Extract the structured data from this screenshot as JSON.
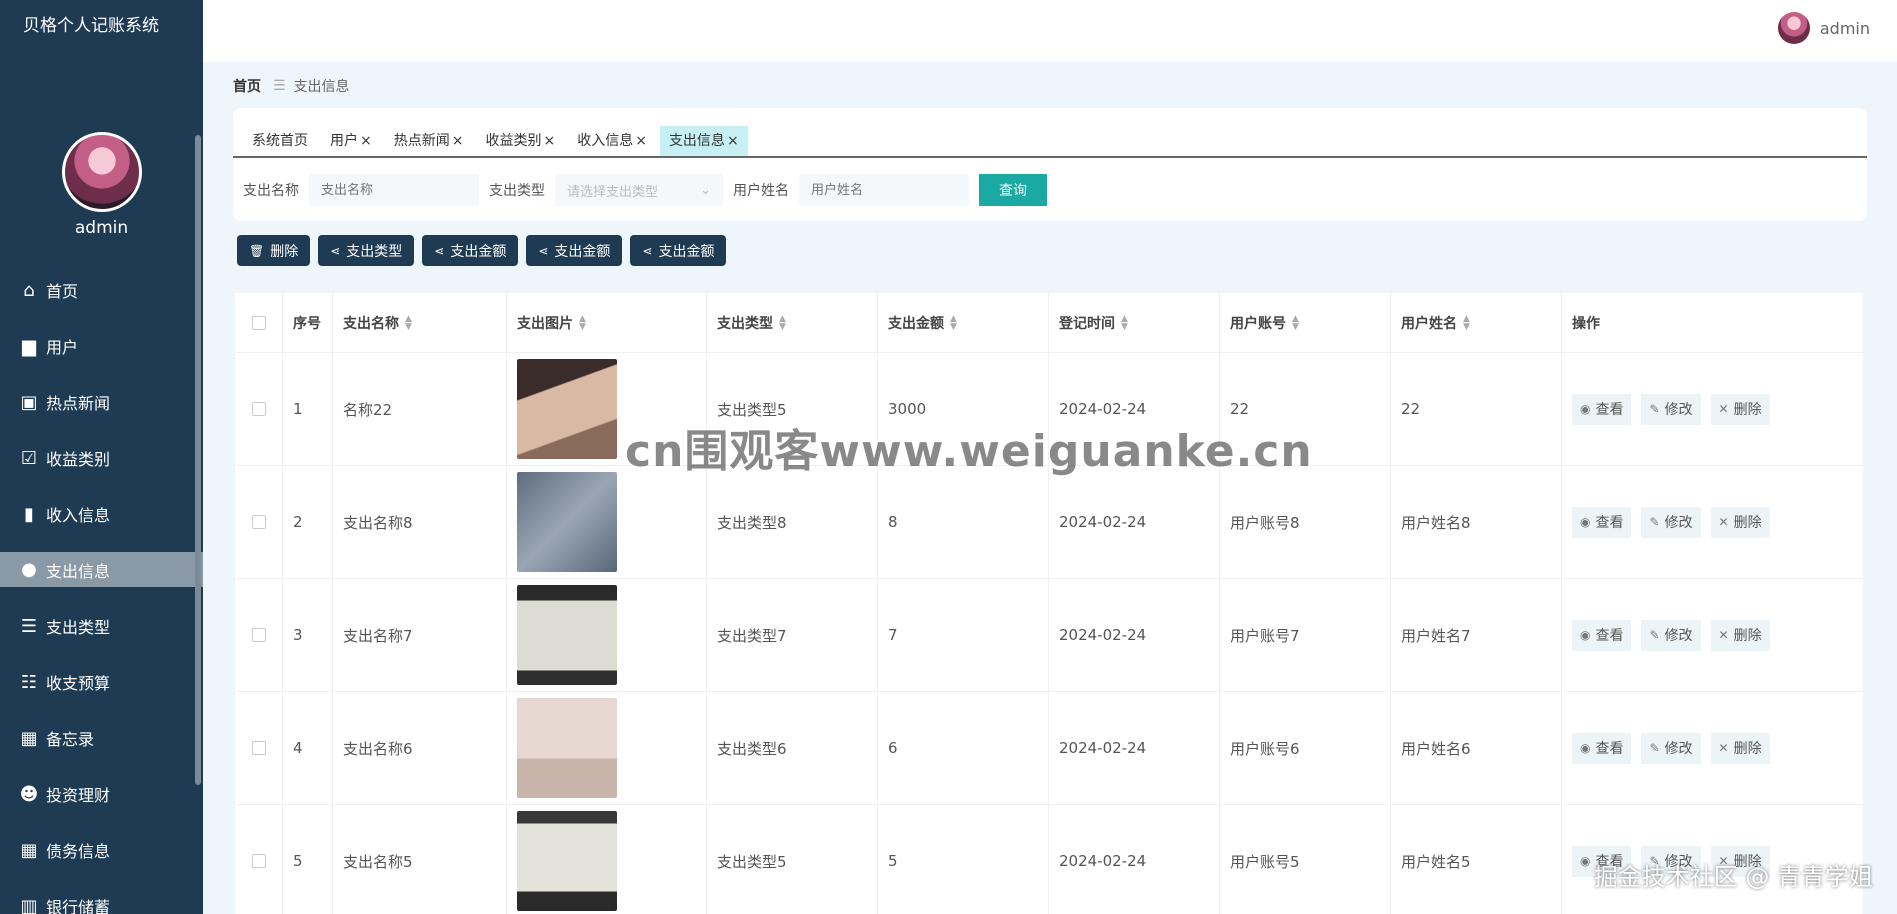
{
  "app": {
    "title": "贝格个人记账系统"
  },
  "profile": {
    "name": "admin"
  },
  "header": {
    "user_name": "admin"
  },
  "sidebar": {
    "items": [
      {
        "label": "首页",
        "icon": "home-icon"
      },
      {
        "label": "用户",
        "icon": "user-card-icon"
      },
      {
        "label": "热点新闻",
        "icon": "news-icon"
      },
      {
        "label": "收益类别",
        "icon": "clipboard-check-icon"
      },
      {
        "label": "收入信息",
        "icon": "bar-chart-icon"
      },
      {
        "label": "支出信息",
        "icon": "bulb-icon",
        "active": true
      },
      {
        "label": "支出类型",
        "icon": "list-icon"
      },
      {
        "label": "收支预算",
        "icon": "sliders-icon"
      },
      {
        "label": "备忘录",
        "icon": "grid-icon"
      },
      {
        "label": "投资理财",
        "icon": "person-icon"
      },
      {
        "label": "债务信息",
        "icon": "grid-icon"
      },
      {
        "label": "银行储蓄",
        "icon": "bank-icon"
      }
    ]
  },
  "breadcrumb": {
    "home": "首页",
    "current": "支出信息"
  },
  "tabs": [
    {
      "label": "系统首页",
      "closable": false
    },
    {
      "label": "用户",
      "closable": true
    },
    {
      "label": "热点新闻",
      "closable": true
    },
    {
      "label": "收益类别",
      "closable": true
    },
    {
      "label": "收入信息",
      "closable": true
    },
    {
      "label": "支出信息",
      "closable": true,
      "active": true
    }
  ],
  "search": {
    "name_label": "支出名称",
    "name_placeholder": "支出名称",
    "type_label": "支出类型",
    "type_placeholder": "请选择支出类型",
    "user_label": "用户姓名",
    "user_placeholder": "用户姓名",
    "query_label": "查询"
  },
  "actions": [
    {
      "label": "删除",
      "icon": "trash-icon"
    },
    {
      "label": "支出类型",
      "icon": "share-icon"
    },
    {
      "label": "支出金额",
      "icon": "share-icon"
    },
    {
      "label": "支出金额",
      "icon": "share-icon"
    },
    {
      "label": "支出金额",
      "icon": "share-icon"
    }
  ],
  "table": {
    "headers": {
      "no": "序号",
      "name": "支出名称",
      "image": "支出图片",
      "type": "支出类型",
      "amount": "支出金额",
      "time": "登记时间",
      "account": "用户账号",
      "user": "用户姓名",
      "ops": "操作"
    },
    "op_labels": {
      "view": "查看",
      "edit": "修改",
      "delete": "删除"
    },
    "rows": [
      {
        "no": "1",
        "name": "名称22",
        "type": "支出类型5",
        "amount": "3000",
        "time": "2024-02-24",
        "account": "22",
        "user": "22"
      },
      {
        "no": "2",
        "name": "支出名称8",
        "type": "支出类型8",
        "amount": "8",
        "time": "2024-02-24",
        "account": "用户账号8",
        "user": "用户姓名8"
      },
      {
        "no": "3",
        "name": "支出名称7",
        "type": "支出类型7",
        "amount": "7",
        "time": "2024-02-24",
        "account": "用户账号7",
        "user": "用户姓名7"
      },
      {
        "no": "4",
        "name": "支出名称6",
        "type": "支出类型6",
        "amount": "6",
        "time": "2024-02-24",
        "account": "用户账号6",
        "user": "用户姓名6"
      },
      {
        "no": "5",
        "name": "支出名称5",
        "type": "支出类型5",
        "amount": "5",
        "time": "2024-02-24",
        "account": "用户账号5",
        "user": "用户姓名5"
      }
    ]
  },
  "watermarks": {
    "center": "cn围观客www.weiguanke.cn",
    "corner": "掘金技术社区 @ 青青学姐"
  }
}
